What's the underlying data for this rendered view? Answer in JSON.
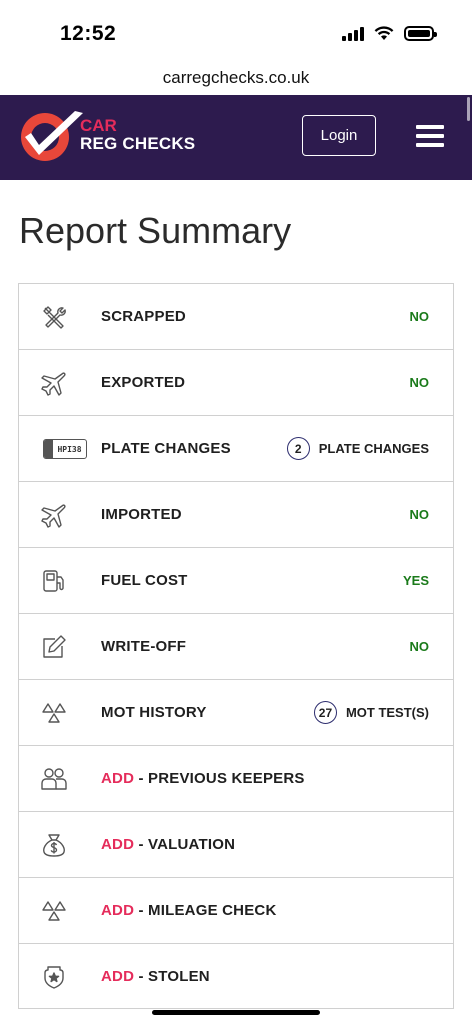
{
  "status_bar": {
    "time": "12:52"
  },
  "browser": {
    "url": "carregchecks.co.uk"
  },
  "header": {
    "logo_line1": "CAR",
    "logo_line2": "REG CHECKS",
    "login_label": "Login"
  },
  "page": {
    "title": "Report Summary"
  },
  "rows": [
    {
      "icon": "tools-icon",
      "label": "SCRAPPED",
      "value": "NO"
    },
    {
      "icon": "plane-icon",
      "label": "EXPORTED",
      "value": "NO"
    },
    {
      "icon": "plate-icon",
      "plate_text": "HPI38",
      "label": "PLATE CHANGES",
      "count": "2",
      "value": "PLATE CHANGES"
    },
    {
      "icon": "plane-icon",
      "label": "IMPORTED",
      "value": "NO"
    },
    {
      "icon": "fuel-icon",
      "label": "FUEL COST",
      "value": "YES"
    },
    {
      "icon": "edit-icon",
      "label": "WRITE-OFF",
      "value": "NO"
    },
    {
      "icon": "cones-icon",
      "label": "MOT HISTORY",
      "count": "27",
      "value": "MOT TEST(S)"
    },
    {
      "icon": "people-icon",
      "add": "ADD",
      "label": " - PREVIOUS KEEPERS"
    },
    {
      "icon": "money-bag-icon",
      "add": "ADD",
      "label": " - VALUATION"
    },
    {
      "icon": "cones-icon",
      "add": "ADD",
      "label": " - MILEAGE CHECK"
    },
    {
      "icon": "badge-icon",
      "add": "ADD",
      "label": " - STOLEN"
    }
  ],
  "colors": {
    "brand": "#2d1b4e",
    "accent": "#e52c5b",
    "positive": "#1a7a1a"
  }
}
